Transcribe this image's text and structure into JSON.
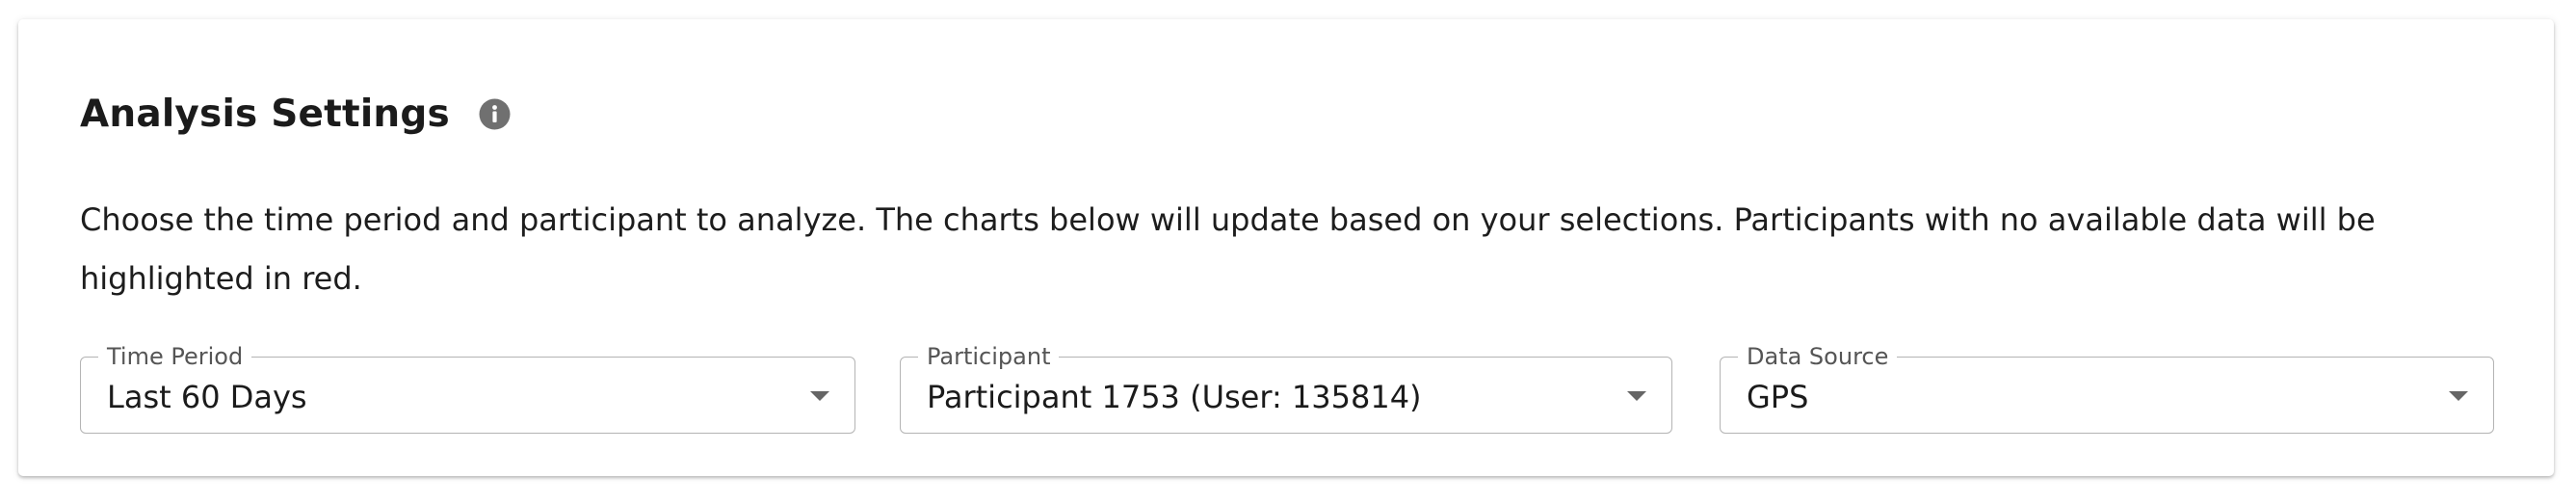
{
  "settings": {
    "title": "Analysis Settings",
    "info_icon": "info-circle-icon",
    "description": "Choose the time period and participant to analyze. The charts below will update based on your selections. Participants with no available data will be highlighted in red."
  },
  "fields": {
    "time_period": {
      "label": "Time Period",
      "value": "Last 60 Days"
    },
    "participant": {
      "label": "Participant",
      "value": "Participant 1753 (User: 135814)"
    },
    "data_source": {
      "label": "Data Source",
      "value": "GPS"
    }
  },
  "colors": {
    "icon": "#707070",
    "border": "#b4b4b4",
    "caret": "#666666"
  }
}
